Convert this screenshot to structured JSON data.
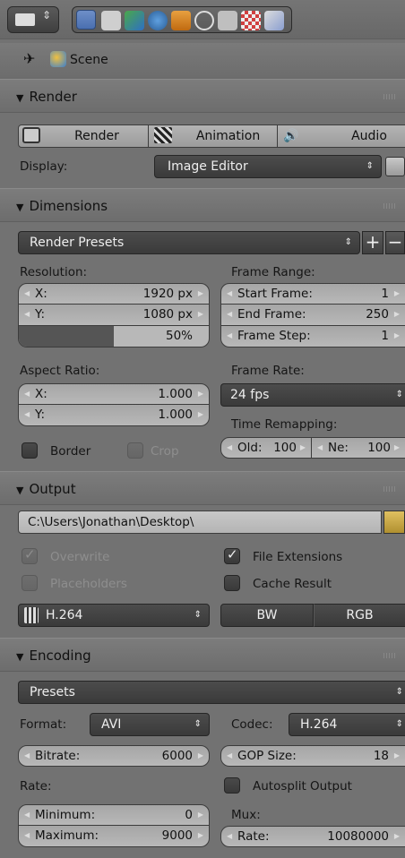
{
  "breadcrumb": {
    "scene_label": "Scene"
  },
  "render": {
    "header": "Render",
    "buttons": {
      "render": "Render",
      "animation": "Animation",
      "audio": "Audio"
    },
    "display_label": "Display:",
    "display_value": "Image Editor"
  },
  "dimensions": {
    "header": "Dimensions",
    "presets": "Render Presets",
    "resolution_label": "Resolution:",
    "res_x_label": "X:",
    "res_x_value": "1920 px",
    "res_y_label": "Y:",
    "res_y_value": "1080 px",
    "res_percent": "50%",
    "res_percent_fraction": 0.5,
    "aspect_label": "Aspect Ratio:",
    "aspect_x_label": "X:",
    "aspect_x_value": "1.000",
    "aspect_y_label": "Y:",
    "aspect_y_value": "1.000",
    "border_label": "Border",
    "crop_label": "Crop",
    "frame_range_label": "Frame Range:",
    "start_label": "Start Frame:",
    "start_value": "1",
    "end_label": "End Frame:",
    "end_value": "250",
    "step_label": "Frame Step:",
    "step_value": "1",
    "frame_rate_label": "Frame Rate:",
    "frame_rate_value": "24 fps",
    "remap_label": "Time Remapping:",
    "old_label": "Old:",
    "old_value": "100",
    "new_label": "Ne:",
    "new_value": "100"
  },
  "output": {
    "header": "Output",
    "path": "C:\\Users\\Jonathan\\Desktop\\",
    "overwrite": "Overwrite",
    "file_extensions": "File Extensions",
    "placeholders": "Placeholders",
    "cache_result": "Cache Result",
    "format": "H.264",
    "bw": "BW",
    "rgb": "RGB"
  },
  "encoding": {
    "header": "Encoding",
    "presets": "Presets",
    "format_label": "Format:",
    "format_value": "AVI",
    "codec_label": "Codec:",
    "codec_value": "H.264",
    "bitrate_label": "Bitrate:",
    "bitrate_value": "6000",
    "gop_label": "GOP Size:",
    "gop_value": "18",
    "rate_label": "Rate:",
    "autosplit": "Autosplit Output",
    "min_label": "Minimum:",
    "min_value": "0",
    "mux_label": "Mux:",
    "max_label": "Maximum:",
    "max_value": "9000",
    "mux_rate_label": "Rate:",
    "mux_rate_value": "10080000"
  },
  "colors": {
    "accent_blue": "#5680c2",
    "panel": "#727272",
    "dark_button": "#3f3f3f"
  }
}
